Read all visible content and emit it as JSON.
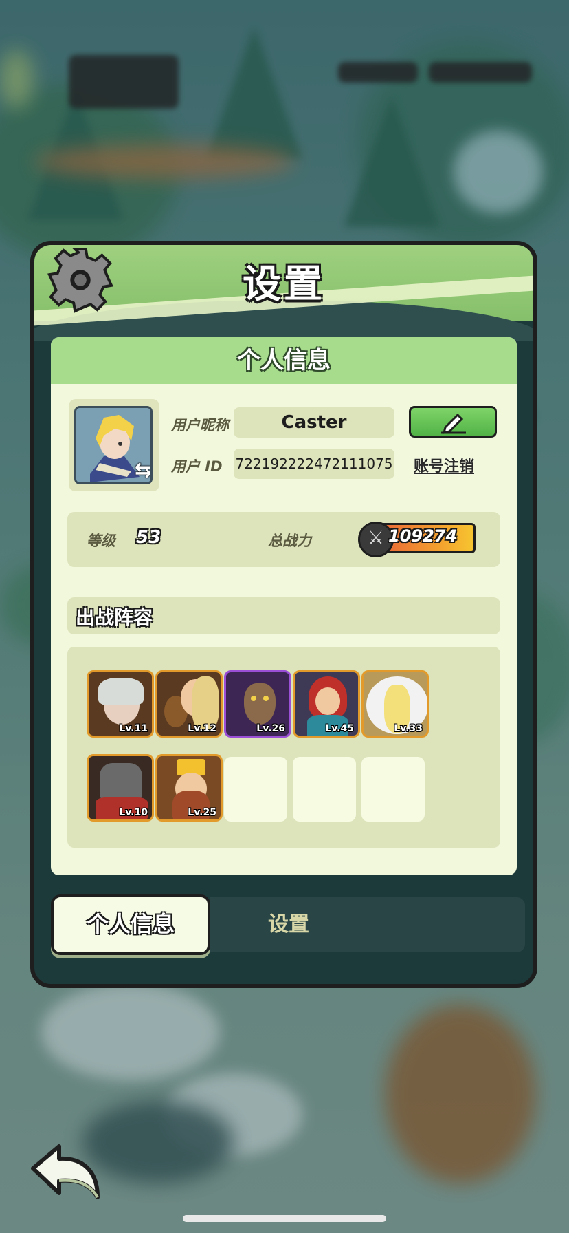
{
  "title": "设置",
  "section_title": "个人信息",
  "profile": {
    "nickname_label": "用户昵称",
    "nickname_value": "Caster",
    "id_label": "用户  ID",
    "id_value": "722192222472111075",
    "cancel_account": "账号注销"
  },
  "stats": {
    "level_label": "等级",
    "level_value": "53",
    "power_label": "总战力",
    "power_value": "109274"
  },
  "lineup": {
    "title": "出战阵容",
    "heroes": [
      {
        "level": "Lv.11",
        "frame": "gold",
        "portrait": "white-haired-antler-hero"
      },
      {
        "level": "Lv.12",
        "frame": "gold",
        "portrait": "lute-bard-hero"
      },
      {
        "level": "Lv.26",
        "frame": "purple",
        "portrait": "goat-demon-hero"
      },
      {
        "level": "Lv.45",
        "frame": "gold",
        "portrait": "red-haired-hero"
      },
      {
        "level": "Lv.33",
        "frame": "gold",
        "portrait": "white-winged-hero"
      },
      {
        "level": "Lv.10",
        "frame": "gold",
        "portrait": "dark-knight-hero"
      },
      {
        "level": "Lv.25",
        "frame": "gold",
        "portrait": "bearded-king-hero"
      }
    ],
    "empty_slots": 3
  },
  "tabs": {
    "personal_info": "个人信息",
    "settings": "设置"
  },
  "colors": {
    "header_green": "#86c06b",
    "card_bg": "#f2f8dc",
    "edit_green": "#52b347",
    "power_orange": "#f3a12e"
  }
}
